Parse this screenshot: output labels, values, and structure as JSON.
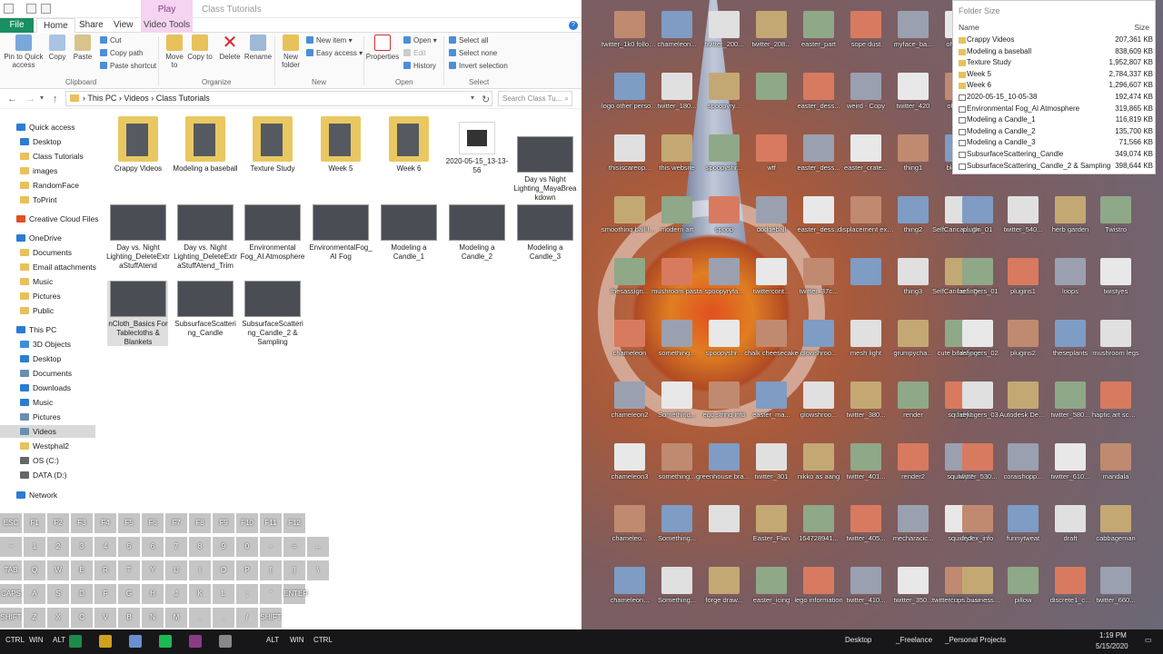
{
  "explorer": {
    "title": "Class Tutorials",
    "play_tab": "Play",
    "tabs": [
      "File",
      "Home",
      "Share",
      "View",
      "Video Tools"
    ],
    "ribbon": {
      "pin": "Pin to Quick access",
      "copy": "Copy",
      "paste": "Paste",
      "cut": "Cut",
      "copy_path": "Copy path",
      "paste_shortcut": "Paste shortcut",
      "move_to": "Move to",
      "copy_to": "Copy to",
      "delete": "Delete",
      "rename": "Rename",
      "new_folder": "New folder",
      "new_item": "New item",
      "easy_access": "Easy access",
      "properties": "Properties",
      "open": "Open",
      "edit": "Edit",
      "history": "History",
      "select_all": "Select all",
      "select_none": "Select none",
      "invert_selection": "Invert selection",
      "groups": [
        "Clipboard",
        "Organize",
        "New",
        "Open",
        "Select"
      ]
    },
    "address": {
      "path": [
        "This PC",
        "Videos",
        "Class Tutorials"
      ],
      "search_placeholder": "Search Class Tu..."
    },
    "nav": [
      {
        "label": "Quick access",
        "color": "#2b7cd3"
      },
      {
        "label": "Desktop",
        "color": "#2b7cd3"
      },
      {
        "label": "Class Tutorials",
        "color": "#e8c15b"
      },
      {
        "label": "images",
        "color": "#e8c15b"
      },
      {
        "label": "RandomFace",
        "color": "#e8c15b"
      },
      {
        "label": "ToPrint",
        "color": "#e8c15b"
      },
      {
        "label": "Creative Cloud Files",
        "color": "#e34f26"
      },
      {
        "label": "OneDrive",
        "color": "#2b7cd3"
      },
      {
        "label": "Documents",
        "color": "#e8c15b"
      },
      {
        "label": "Email attachments",
        "color": "#e8c15b"
      },
      {
        "label": "Music",
        "color": "#e8c15b"
      },
      {
        "label": "Pictures",
        "color": "#e8c15b"
      },
      {
        "label": "Public",
        "color": "#e8c15b"
      },
      {
        "label": "This PC",
        "color": "#2b7cd3"
      },
      {
        "label": "3D Objects",
        "color": "#3c8fd9"
      },
      {
        "label": "Desktop",
        "color": "#2b7cd3"
      },
      {
        "label": "Documents",
        "color": "#6a8fb0"
      },
      {
        "label": "Downloads",
        "color": "#2b7cd3"
      },
      {
        "label": "Music",
        "color": "#2b7cd3"
      },
      {
        "label": "Pictures",
        "color": "#6a8fb0"
      },
      {
        "label": "Videos",
        "color": "#6a8fb0"
      },
      {
        "label": "Westphal2",
        "color": "#e8c15b"
      },
      {
        "label": "OS (C:)",
        "color": "#666"
      },
      {
        "label": "DATA (D:)",
        "color": "#666"
      },
      {
        "label": "Network",
        "color": "#2b7cd3"
      }
    ],
    "files": [
      {
        "label": "Crappy Videos",
        "kind": "folder"
      },
      {
        "label": "Modeling a baseball",
        "kind": "folder"
      },
      {
        "label": "Texture Study",
        "kind": "folder"
      },
      {
        "label": "Week 5",
        "kind": "folder"
      },
      {
        "label": "Week 6",
        "kind": "folder"
      },
      {
        "label": "2020-05-15_13-13-56",
        "kind": "video"
      },
      {
        "label": "Day vs Night Lighting_MayaBreakdown",
        "kind": "thumb"
      },
      {
        "label": "Day vs. Night Lighting_DeleteExtraStuffAtend",
        "kind": "thumb"
      },
      {
        "label": "Day vs. Night Lighting_DeleteExtraStuffAtend_Trim",
        "kind": "thumb"
      },
      {
        "label": "Environmental Fog_AI Atmosphere",
        "kind": "thumb"
      },
      {
        "label": "EnvironmentalFog_AI Fog",
        "kind": "thumb"
      },
      {
        "label": "Modeling a Candle_1",
        "kind": "thumb"
      },
      {
        "label": "Modeling a Candle_2",
        "kind": "thumb"
      },
      {
        "label": "Modeling a Candle_3",
        "kind": "thumb"
      },
      {
        "label": "nCloth_Basics For Tablecloths & Blankets",
        "kind": "thumb"
      },
      {
        "label": "SubsurfaceScattering_Candle",
        "kind": "thumb"
      },
      {
        "label": "SubsurfaceScattering_Candle_2 & Sampling",
        "kind": "thumb"
      }
    ]
  },
  "keyboard": {
    "row1": [
      "ESC",
      "F1",
      "F2",
      "F3",
      "F4",
      "F5",
      "F6",
      "F7",
      "F8",
      "F9",
      "F10",
      "F11",
      "F12"
    ],
    "row2": [
      "~",
      "1",
      "2",
      "3",
      "4",
      "5",
      "6",
      "7",
      "8",
      "9",
      "0",
      "-",
      "=",
      "←"
    ],
    "row3": [
      "TAB",
      "Q",
      "W",
      "E",
      "R",
      "T",
      "Y",
      "U",
      "I",
      "O",
      "P",
      "[",
      "]",
      "\\"
    ],
    "row4": [
      "CAPS",
      "A",
      "S",
      "D",
      "F",
      "G",
      "H",
      "J",
      "K",
      "L",
      ";",
      "'",
      "ENTER"
    ],
    "row5": [
      "SHIFT",
      "Z",
      "X",
      "C",
      "V",
      "B",
      "N",
      "M",
      ",",
      ".",
      "/",
      "SHIFT"
    ]
  },
  "taskbar": {
    "left_keys": [
      "CTRL",
      "WIN",
      "ALT"
    ],
    "mid_keys": [
      "ALT",
      "WIN",
      "CTRL"
    ],
    "toolbars": [
      "Desktop",
      "_Freelance",
      "_Personal Projects"
    ],
    "time": "1:19 PM",
    "date": "5/15/2020"
  },
  "folder_size": {
    "title": "Folder Size",
    "col_name": "Name",
    "col_size": "Size",
    "rows": [
      {
        "name": "Crappy Videos",
        "size": "207,361 KB",
        "kind": "folder"
      },
      {
        "name": "Modeling a baseball",
        "size": "838,609 KB",
        "kind": "folder"
      },
      {
        "name": "Texture Study",
        "size": "1,952,807 KB",
        "kind": "folder"
      },
      {
        "name": "Week 5",
        "size": "2,784,337 KB",
        "kind": "folder"
      },
      {
        "name": "Week 6",
        "size": "1,296,607 KB",
        "kind": "folder"
      },
      {
        "name": "2020-05-15_10-05-38",
        "size": "192,474 KB",
        "kind": "file"
      },
      {
        "name": "Environmental Fog_AI Atmosphere",
        "size": "319,865 KB",
        "kind": "file"
      },
      {
        "name": "Modeling a Candle_1",
        "size": "116,819 KB",
        "kind": "file"
      },
      {
        "name": "Modeling a Candle_2",
        "size": "135,700 KB",
        "kind": "file"
      },
      {
        "name": "Modeling a Candle_3",
        "size": "71,566 KB",
        "kind": "file"
      },
      {
        "name": "SubsurfaceScattering_Candle",
        "size": "349,074 KB",
        "kind": "file"
      },
      {
        "name": "SubsurfaceScattering_Candle_2 & Sampling",
        "size": "398,644 KB",
        "kind": "file"
      }
    ]
  },
  "desktop_icons": [
    [
      "twitter_1k0 followers",
      "chameleon...",
      "twitter_200...",
      "twitter_208...",
      "easter_part",
      "sope dust",
      "myface_ba...",
      "oh_goo..."
    ],
    [
      "logo other person...",
      "twitter_180...",
      "spoopyry...",
      "",
      "easter_dess...",
      "weird - Copy",
      "twitter_420",
      "oh goo..."
    ],
    [
      "thisiscareop...",
      "this website",
      "spoopyshr...",
      "wtf",
      "easter_dess...",
      "easter_crate...",
      "thing1",
      "blender..."
    ],
    [
      "smoothing ball loops",
      "modern art",
      "spoop",
      "dodgeball",
      "easter_dess...",
      "displacement exporting",
      "thing2",
      "SelfCaricat... DispMap"
    ],
    [
      "thesassign...",
      "mushroom pasta",
      "spoopyryfa...",
      "twittercont...",
      "twitter_37c...",
      "",
      "thing3",
      "SelfCaricat... DispMap.txt"
    ],
    [
      "chameleon",
      "something...",
      "spoopyshr...",
      "chalk cheesecake",
      "glowshroo...",
      "mesh light",
      "grumpycha...",
      "cute birds.jpg..."
    ],
    [
      "chameleon2",
      "Something...",
      "egg string info",
      "easter_ma...",
      "glowshroo...",
      "twitter_380...",
      "render",
      "squidly1"
    ],
    [
      "chameleon3",
      "something...",
      "greenhouse bracket",
      "twitter_301",
      "nikko as aang",
      "twitter_401...",
      "render2",
      "squidly 2"
    ],
    [
      "chameleo...",
      "Something...",
      "",
      "Easter_Flan",
      "164728941...",
      "twitter_405...",
      "mecharacic...",
      "squidly3"
    ],
    [
      "chameleon...",
      "Something...",
      "forge draw...",
      "easter_icing",
      "lego information",
      "twitter_410...",
      "twitter_350...",
      "twittercont... winner"
    ]
  ],
  "desktop_icons_right": [
    [
      "",
      "",
      "",
      "",
      ""
    ],
    [
      "",
      "",
      "",
      "",
      ""
    ],
    [
      "",
      "",
      "",
      "",
      ""
    ],
    [
      "plugin_01",
      "twitter_540...",
      "herb garden",
      "Twistro",
      ""
    ],
    [
      "faefingers_01",
      "plugins1",
      "loops",
      "twistyes",
      ""
    ],
    [
      "faefingers_02",
      "plugins2",
      "theseplants",
      "mushroom legs",
      ""
    ],
    [
      "faefingers_03",
      "Autodesk Desktop App",
      "twitter_580...",
      "haptic art sculpture",
      ""
    ],
    [
      "twitter_530...",
      "coraishopp...",
      "twitter_610...",
      "mandala",
      ""
    ],
    [
      "fedex_info",
      "funnytweat",
      "draft",
      "cabbageman",
      ""
    ],
    [
      "ups business info",
      "pillow",
      "discrete1_c...",
      "twitter_660...",
      ""
    ]
  ]
}
